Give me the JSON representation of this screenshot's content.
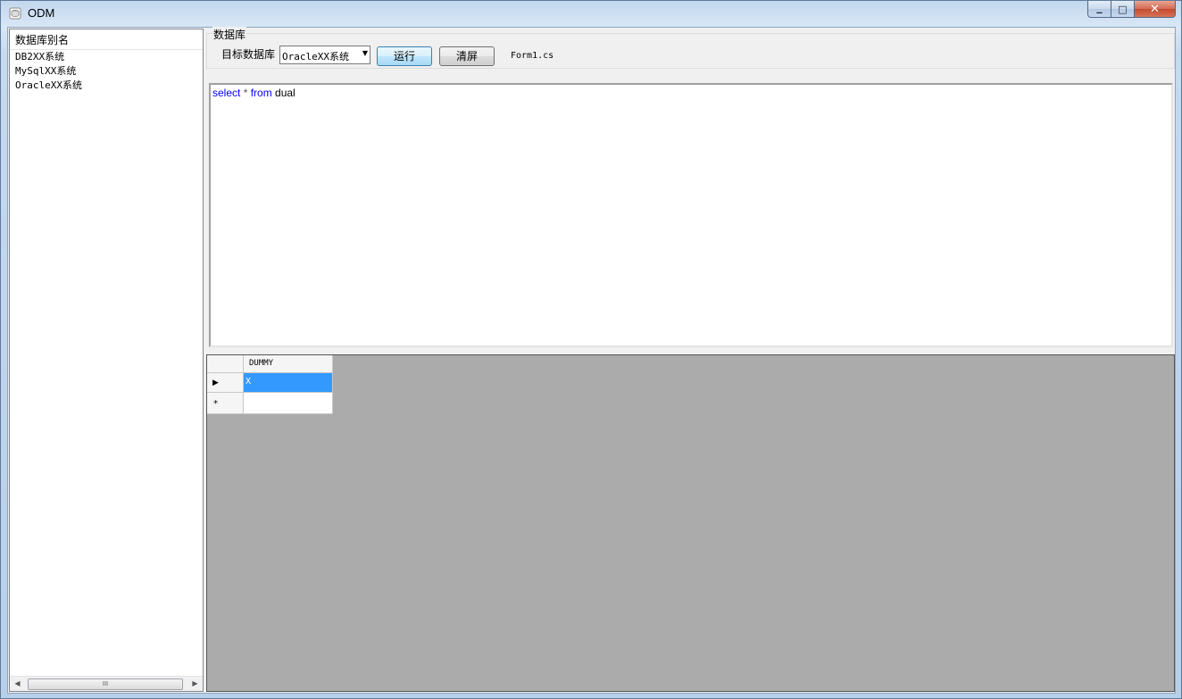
{
  "window": {
    "title": "ODM"
  },
  "caption": {
    "minimize": "▁",
    "maximize": "□",
    "close": "✕"
  },
  "left_panel": {
    "header": "数据库别名",
    "items": [
      "DB2XX系统",
      "MySqlXX系统",
      "OracleXX系统"
    ],
    "scrollbar_thumb": "III"
  },
  "toolbar": {
    "group_label": "数据库",
    "target_label": "目标数据库",
    "combo_value": "OracleXX系统",
    "run_label": "运行",
    "clear_label": "清屏",
    "form_label": "Form1.cs"
  },
  "editor": {
    "tokens": [
      "select",
      " * ",
      "from",
      " dual"
    ]
  },
  "grid": {
    "columns": [
      "DUMMY"
    ],
    "rows": [
      [
        "X"
      ]
    ],
    "current_row_marker": "▶",
    "new_row_marker": "*"
  },
  "colors": {
    "selection": "#3399ff",
    "keyword": "#0000ff",
    "grid_background": "#ababab"
  }
}
